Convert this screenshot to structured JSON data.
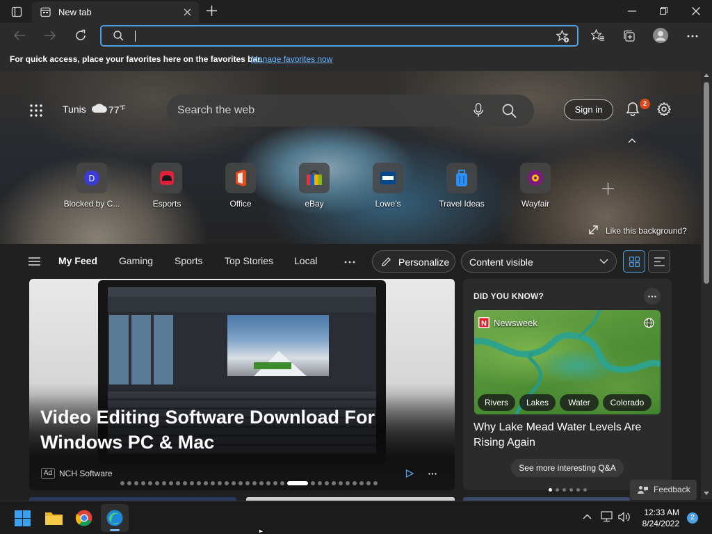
{
  "window": {
    "tab_title": "New tab",
    "address_value": "",
    "favorites_hint": "For quick access, place your favorites here on the favorites bar.",
    "favorites_link": "Manage favorites now"
  },
  "hero": {
    "city": "Tunis",
    "temperature": "77",
    "temp_unit": "°F",
    "search_placeholder": "Search the web",
    "signin_label": "Sign in",
    "notification_count": "2",
    "quick_links": [
      {
        "label": "Blocked by C...",
        "icon": "blocked-site-icon"
      },
      {
        "label": "Esports",
        "icon": "esports-controller-icon"
      },
      {
        "label": "Office",
        "icon": "office-logo-icon"
      },
      {
        "label": "eBay",
        "icon": "ebay-bag-icon"
      },
      {
        "label": "Lowe's",
        "icon": "lowes-logo-icon"
      },
      {
        "label": "Travel Ideas",
        "icon": "suitcase-icon"
      },
      {
        "label": "Wayfair",
        "icon": "wayfair-logo-icon"
      }
    ],
    "like_background": "Like this background?"
  },
  "feed_nav": {
    "tabs": [
      "My Feed",
      "Gaming",
      "Sports",
      "Top Stories",
      "Local"
    ],
    "personalize": "Personalize",
    "content_visible": "Content visible"
  },
  "main_card": {
    "headline": "Video Editing Software Download For Windows PC & Mac",
    "ad_badge": "Ad",
    "advertiser": "NCH Software"
  },
  "side_card": {
    "section_title": "DID YOU KNOW?",
    "source": "Newsweek",
    "tags": [
      "Rivers",
      "Lakes",
      "Water",
      "Colorado"
    ],
    "headline": "Why Lake Mead Water Levels Are Rising Again",
    "see_more": "See more interesting Q&A"
  },
  "feedback_label": "Feedback",
  "taskbar": {
    "time": "12:33 AM",
    "date": "8/24/2022",
    "notification_count": "2"
  },
  "colors": {
    "accent": "#4f9fe3",
    "link": "#6cb4ff",
    "badge": "#d64a1f"
  }
}
